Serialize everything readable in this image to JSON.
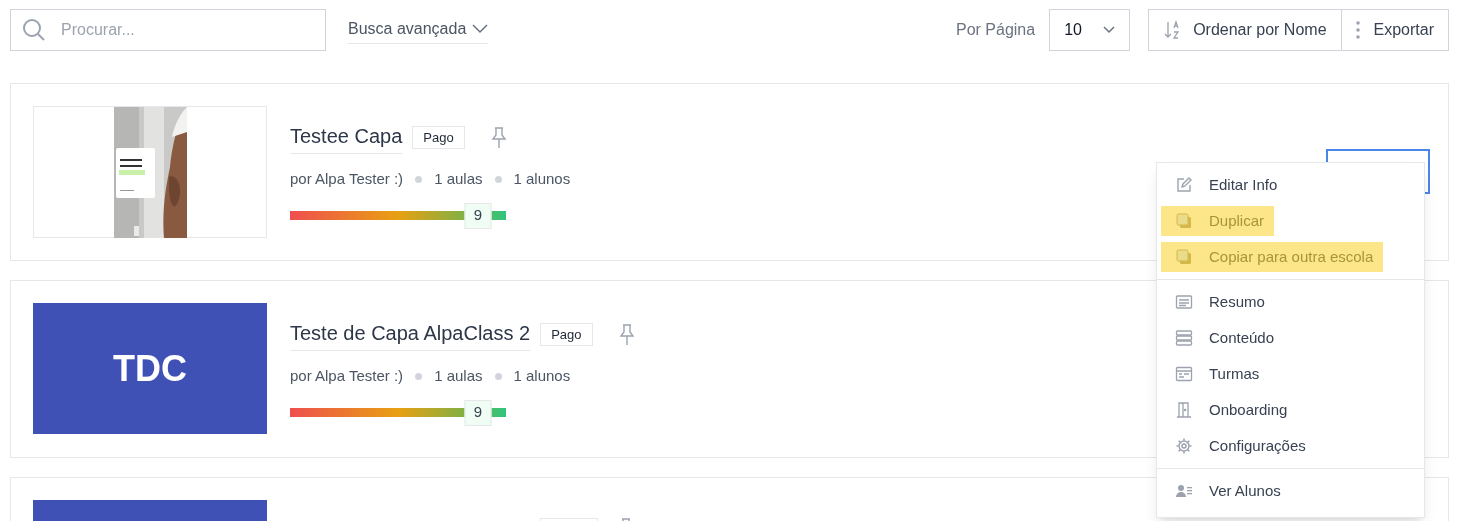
{
  "toolbar": {
    "search": {
      "placeholder": "Procurar..."
    },
    "advanced_search": "Busca avançada",
    "per_page_label": "Por Página",
    "per_page_value": "10",
    "sort_button": "Ordenar por Nome",
    "export_button": "Exportar"
  },
  "courses": [
    {
      "title": "Testee Capa",
      "badge": "Pago",
      "author": "por Alpa Tester :)",
      "lessons": "1 aulas",
      "students": "1 alunos",
      "score": "9",
      "level": 0.87,
      "menu_open": true
    },
    {
      "thumbnail": {
        "kind": "initials",
        "text": "TDC"
      },
      "title": "Teste de Capa AlpaClass 2",
      "badge": "Pago",
      "author": "por Alpa Tester :)",
      "lessons": "1 aulas",
      "students": "1 alunos",
      "score": "9",
      "level": 0.87,
      "menu_open": false
    },
    {
      "thumbnail": {
        "kind": "blank"
      }
    }
  ],
  "menu": {
    "sections": [
      [
        {
          "label": "Editar Info",
          "kind": "edit",
          "highlighted": false
        },
        {
          "label": "Duplicar",
          "kind": "copy",
          "highlighted": true
        },
        {
          "label": "Copiar para outra escola",
          "kind": "copy",
          "highlighted": true
        }
      ],
      [
        {
          "label": "Resumo",
          "kind": "lines",
          "highlighted": false
        },
        {
          "label": "Conteúdo",
          "kind": "stack",
          "highlighted": false
        },
        {
          "label": "Turmas",
          "kind": "calendar",
          "highlighted": false
        },
        {
          "label": "Onboarding",
          "kind": "door",
          "highlighted": false
        },
        {
          "label": "Configurações",
          "kind": "gear",
          "highlighted": false
        }
      ],
      [
        {
          "label": "Ver Alunos",
          "kind": "users",
          "highlighted": false
        }
      ]
    ]
  }
}
